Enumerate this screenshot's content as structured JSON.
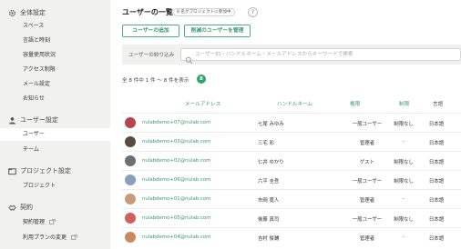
{
  "sidebar": {
    "sections": [
      {
        "icon": "gear-icon",
        "label": "全体設定",
        "items": [
          "スペース",
          "言語と時刻",
          "容量使用状況",
          "アクセス制限",
          "メール設定",
          "お知らせ"
        ]
      },
      {
        "icon": "user-icon",
        "label": "ユーザー設定",
        "items": [
          "ユーザー",
          "チーム"
        ]
      },
      {
        "icon": "folder-icon",
        "label": "プロジェクト設定",
        "items": [
          "プロジェクト"
        ]
      },
      {
        "icon": "contract-icon",
        "label": "契約",
        "items": [
          "契約管理",
          "利用プランの変更"
        ]
      }
    ],
    "active_item": "ユーザー"
  },
  "header": {
    "title": "ユーザーの一覧",
    "badge": "8 名がプロジェクトに参加中",
    "help": "?"
  },
  "actions": {
    "add_user": "ユーザーの追加",
    "manage_reduced": "削減のユーザーを管理"
  },
  "filter": {
    "label": "ユーザーの絞り込み",
    "placeholder": "ユーザーID・ハンドルネーム・メールアドレスからキーワードで検索"
  },
  "summary": {
    "text": "全 8 件中 1 件 〜 8 件を表示",
    "count": "8"
  },
  "table": {
    "columns": [
      "メールアドレス",
      "ハンドルネーム",
      "権限",
      "制限",
      "言語"
    ],
    "rows": [
      {
        "email": "nulabdemo+07@nulab.com",
        "handle": "七尾 みゆみ",
        "perm": "一般ユーザー",
        "limit": "制限なし",
        "lang": "日本語",
        "avatar_color": "#b8434c"
      },
      {
        "email": "nulabdemo+03@nulab.com",
        "handle": "三宅 彩",
        "perm": "管理者",
        "limit": "-",
        "lang": "日本語",
        "avatar_color": "#5a4a42"
      },
      {
        "email": "nulabdemo+02@nulab.com",
        "handle": "仁井 ゆかり",
        "perm": "ゲスト",
        "limit": "制限なし",
        "lang": "日本語",
        "avatar_color": "#6e6e78"
      },
      {
        "email": "nulabdemo+06@nulab.com",
        "handle": "六平 圭吾",
        "perm": "一般ユーザー",
        "limit": "制限なし",
        "lang": "日本語",
        "avatar_color": "#8aa0b8"
      },
      {
        "email": "nulabdemo+01@nulab.com",
        "handle": "市岡 寛人",
        "perm": "管理者",
        "limit": "-",
        "lang": "日本語",
        "avatar_color": "#c79a7a"
      },
      {
        "email": "nulabdemo+05@nulab.com",
        "handle": "後藤 真司",
        "perm": "一般ユーザー",
        "limit": "制限なし",
        "lang": "日本語",
        "avatar_color": "#d0605a"
      },
      {
        "email": "nulabdemo+04@nulab.com",
        "handle": "吉村 俊輔",
        "perm": "管理者",
        "limit": "-",
        "lang": "日本語",
        "avatar_color": "#c98a5e"
      }
    ]
  },
  "colors": {
    "accent": "#3a9a6c",
    "sidebar_bg": "#f1f2ef",
    "badge_green": "#2fa46a"
  }
}
